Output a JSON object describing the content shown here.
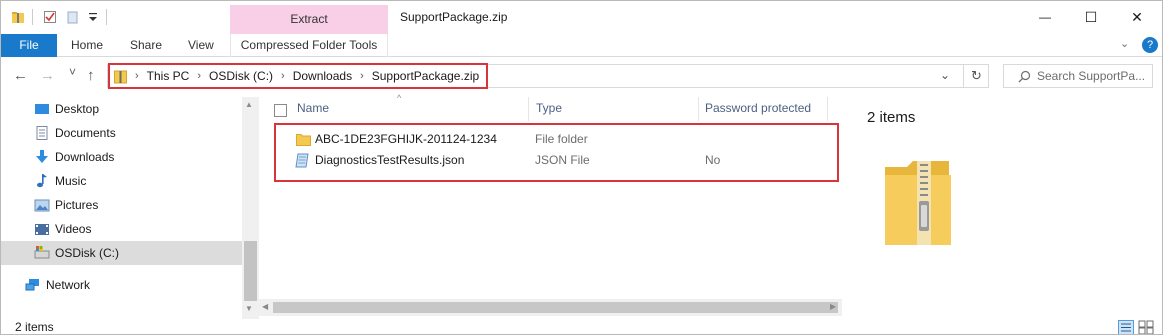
{
  "window": {
    "title": "SupportPackage.zip",
    "context_group": "Extract",
    "controls": {
      "minimize": "—",
      "maximize": "☐",
      "close": "✕"
    }
  },
  "ribbon": {
    "tabs": [
      "File",
      "Home",
      "Share",
      "View"
    ],
    "context_tab": "Compressed Folder Tools",
    "help_icon": "?"
  },
  "nav_buttons": {
    "back": "←",
    "forward": "→",
    "recent": "˅",
    "up": "↑"
  },
  "address": {
    "segments": [
      "This PC",
      "OSDisk (C:)",
      "Downloads",
      "SupportPackage.zip"
    ],
    "separator": "›"
  },
  "search": {
    "placeholder": "Search SupportPa..."
  },
  "sidebar": {
    "items": [
      {
        "label": "Desktop",
        "icon": "desktop-icon"
      },
      {
        "label": "Documents",
        "icon": "documents-icon"
      },
      {
        "label": "Downloads",
        "icon": "downloads-icon"
      },
      {
        "label": "Music",
        "icon": "music-icon"
      },
      {
        "label": "Pictures",
        "icon": "pictures-icon"
      },
      {
        "label": "Videos",
        "icon": "videos-icon"
      },
      {
        "label": "OSDisk (C:)",
        "icon": "drive-icon",
        "selected": true
      },
      {
        "label": "Network",
        "icon": "network-icon"
      }
    ]
  },
  "file_list": {
    "columns": [
      "Name",
      "Type",
      "Password protected"
    ],
    "sort_indicator": "^",
    "rows": [
      {
        "name": "ABC-1DE23FGHIJK-201124-1234",
        "type": "File folder",
        "password_protected": "",
        "icon": "folder-icon"
      },
      {
        "name": "DiagnosticsTestResults.json",
        "type": "JSON File",
        "password_protected": "No",
        "icon": "json-file-icon"
      }
    ]
  },
  "details_pane": {
    "count": "2 items",
    "preview_icon": "zip-folder-icon"
  },
  "status_bar": {
    "count": "2 items"
  },
  "colors": {
    "accent": "#1979ca",
    "context_tab": "#f8cfe6",
    "highlight": "#d9343a",
    "folder": "#f3c94f"
  }
}
